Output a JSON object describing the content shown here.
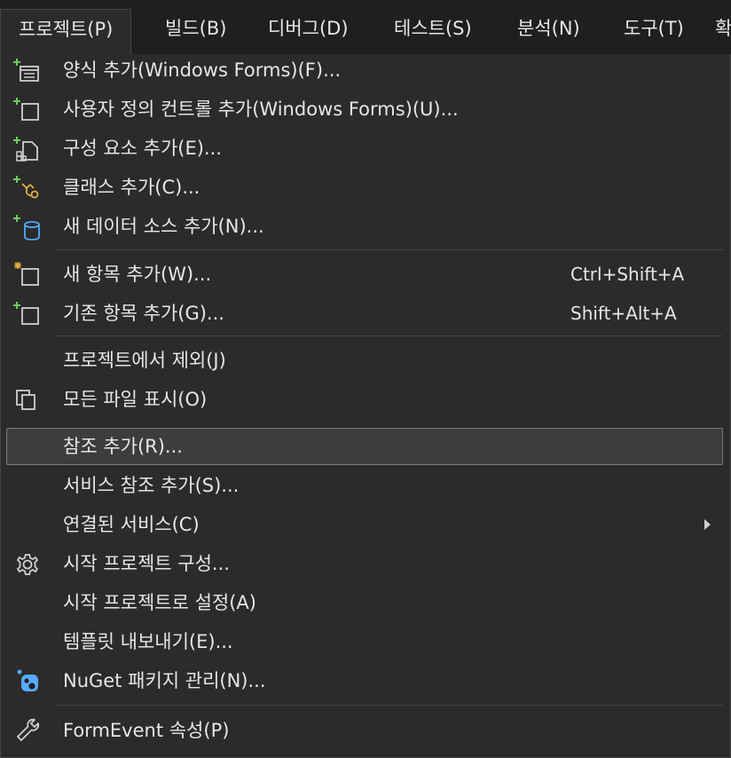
{
  "menubar": {
    "items": [
      {
        "label": "프로젝트(P)"
      },
      {
        "label": "빌드(B)"
      },
      {
        "label": "디버그(D)"
      },
      {
        "label": "테스트(S)"
      },
      {
        "label": "분석(N)"
      },
      {
        "label": "도구(T)"
      },
      {
        "label": "확"
      }
    ]
  },
  "menu": {
    "items": [
      {
        "label": "양식 추가(Windows Forms)(F)...",
        "icon": "add-form-icon"
      },
      {
        "label": "사용자 정의 컨트롤 추가(Windows Forms)(U)...",
        "icon": "add-user-control-icon"
      },
      {
        "label": "구성 요소 추가(E)...",
        "icon": "add-component-icon"
      },
      {
        "label": "클래스 추가(C)...",
        "icon": "add-class-icon"
      },
      {
        "label": "새 데이터 소스 추가(N)...",
        "icon": "add-data-source-icon"
      },
      {
        "label": "새 항목 추가(W)...",
        "shortcut": "Ctrl+Shift+A",
        "icon": "new-item-icon"
      },
      {
        "label": "기존 항목 추가(G)...",
        "shortcut": "Shift+Alt+A",
        "icon": "existing-item-icon"
      },
      {
        "label": "프로젝트에서 제외(J)"
      },
      {
        "label": "모든 파일 표시(O)",
        "icon": "show-all-files-icon"
      },
      {
        "label": "참조 추가(R)..."
      },
      {
        "label": "서비스 참조 추가(S)..."
      },
      {
        "label": "연결된 서비스(C)",
        "icon": "submenu-arrow-icon"
      },
      {
        "label": "시작 프로젝트 구성...",
        "icon": "gear-icon"
      },
      {
        "label": "시작 프로젝트로 설정(A)"
      },
      {
        "label": "템플릿 내보내기(E)..."
      },
      {
        "label": "NuGet 패키지 관리(N)...",
        "icon": "nuget-icon"
      },
      {
        "label": "FormEvent 속성(P)",
        "icon": "wrench-icon"
      }
    ],
    "selected": "참조 추가(R)..."
  },
  "colors": {
    "background": "#1f1f1f",
    "menu_bg": "#2b2b2b",
    "border": "#454545",
    "selected_bg": "#3d3d3d",
    "text": "#e6e6e6",
    "plus_green": "#6ccb5f",
    "nuget_blue": "#55aaff"
  }
}
